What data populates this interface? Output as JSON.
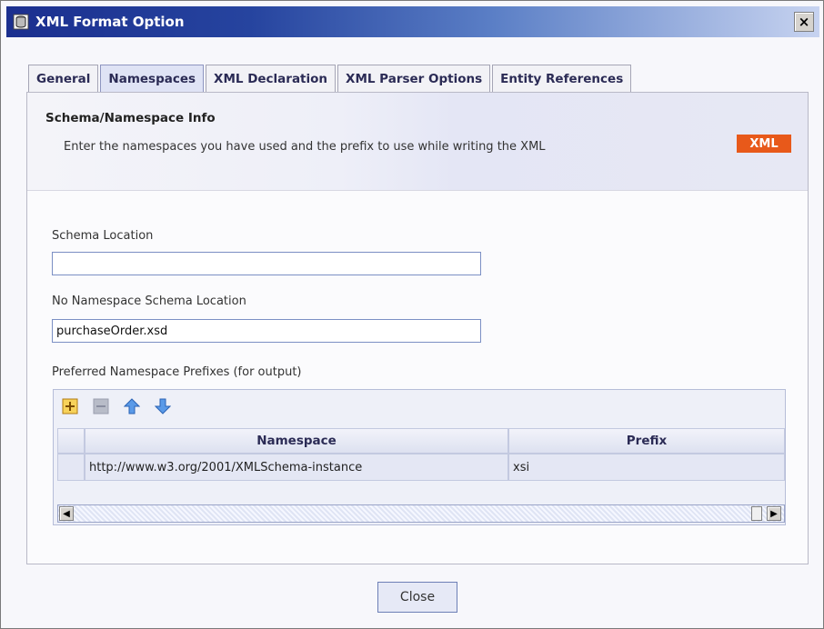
{
  "window": {
    "title": "XML Format Option",
    "close_glyph": "×",
    "title_icon": "db-icon"
  },
  "tabs": [
    {
      "label": "General",
      "active": false
    },
    {
      "label": "Namespaces",
      "active": true
    },
    {
      "label": "XML Declaration",
      "active": false
    },
    {
      "label": "XML Parser Options",
      "active": false
    },
    {
      "label": "Entity References",
      "active": false
    }
  ],
  "info": {
    "title": "Schema/Namespace Info",
    "description": "Enter the namespaces you have used and the prefix to use while writing the XML",
    "badge": "XML"
  },
  "schema_location": {
    "label": "Schema Location",
    "value": ""
  },
  "no_ns_schema_location": {
    "label": "No Namespace Schema Location",
    "value": "purchaseOrder.xsd"
  },
  "prefixes": {
    "label": "Preferred Namespace Prefixes (for output)",
    "toolbar_icons": [
      "add-icon",
      "remove-icon",
      "move-up-icon",
      "move-down-icon"
    ],
    "columns": [
      "Namespace",
      "Prefix"
    ],
    "rows": [
      {
        "namespace": "http://www.w3.org/2001/XMLSchema-instance",
        "prefix": "xsi"
      }
    ]
  },
  "footer": {
    "close_label": "Close"
  },
  "colors": {
    "titlebar_start": "#1b2f8f",
    "badge": "#e8591a",
    "input_border": "#7b8fc4"
  }
}
